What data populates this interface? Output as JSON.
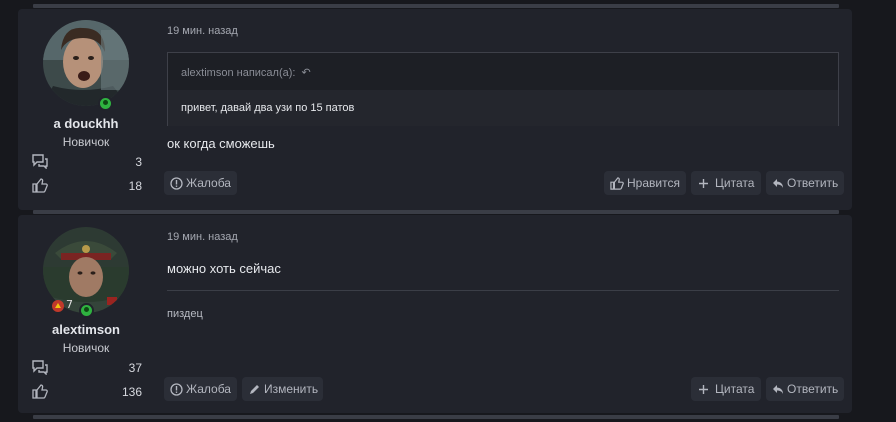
{
  "posts": [
    {
      "author": {
        "name": "a douckhh",
        "role": "Новичок",
        "messages": "3",
        "reactions": "18"
      },
      "time": "19 мин. назад",
      "quote": {
        "header": "alextimson написал(а):",
        "text": "привет, давай два узи по 15 патов"
      },
      "message": "ок когда сможешь",
      "buttons": {
        "report": "Жалоба",
        "like": "Нравится",
        "quote": "Цитата",
        "reply": "Ответить"
      }
    },
    {
      "author": {
        "name": "alextimson",
        "role": "Новичок",
        "messages": "37",
        "reactions": "136"
      },
      "time": "19 мин. назад",
      "message": "можно хоть сейчас",
      "signature": "пиздец",
      "buttons": {
        "report": "Жалоба",
        "edit": "Изменить",
        "quote": "Цитата",
        "reply": "Ответить"
      }
    }
  ],
  "colors": {
    "online": "#2fb340",
    "post_bg": "#21232b",
    "page_bg": "#17181d"
  }
}
